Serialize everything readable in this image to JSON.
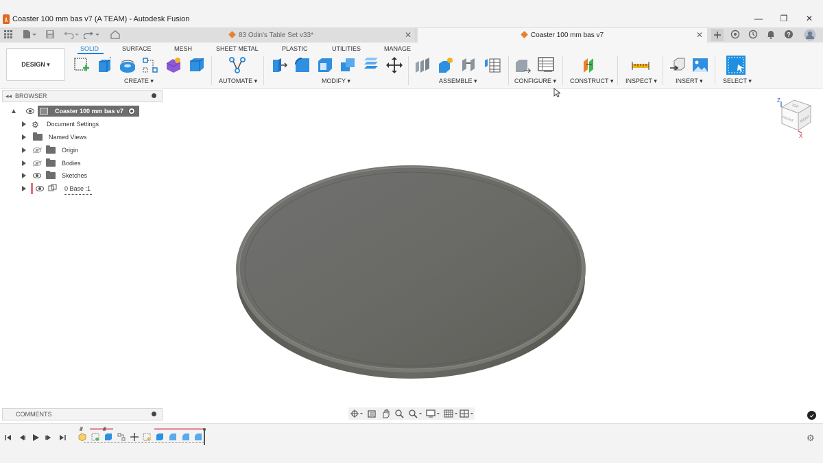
{
  "window": {
    "title": "Coaster 100 mm bas v7 (A TEAM) - Autodesk Fusion",
    "minimize": "—",
    "restore": "❐",
    "close": "✕"
  },
  "tabs": [
    {
      "label": "83 Odin's Table Set v33*",
      "close": "✕",
      "active": false
    },
    {
      "label": "Coaster 100 mm bas v7",
      "close": "✕",
      "active": true
    }
  ],
  "toolbar": {
    "workspace": "DESIGN",
    "workspace_caret": "▾",
    "tabs": [
      "SOLID",
      "SURFACE",
      "MESH",
      "SHEET METAL",
      "PLASTIC",
      "UTILITIES",
      "MANAGE"
    ],
    "groups": [
      "CREATE ▾",
      "AUTOMATE ▾",
      "MODIFY ▾",
      "ASSEMBLE ▾",
      "CONFIGURE ▾",
      "CONSTRUCT ▾",
      "INSPECT ▾",
      "INSERT ▾",
      "SELECT ▾"
    ]
  },
  "browser": {
    "title": "BROWSER",
    "root": "Coaster 100 mm bas v7",
    "items": [
      {
        "label": "Document Settings",
        "icon": "gear-icon"
      },
      {
        "label": "Named Views",
        "icon": "folder-icon"
      },
      {
        "label": "Origin",
        "icon": "folder-icon",
        "visibility": "hidden"
      },
      {
        "label": "Bodies",
        "icon": "folder-icon",
        "visibility": "hidden"
      },
      {
        "label": "Sketches",
        "icon": "folder-icon",
        "visibility": "visible"
      },
      {
        "label": "0 Base :1",
        "icon": "component-icon",
        "visibility": "visible"
      }
    ]
  },
  "comments": {
    "title": "COMMENTS"
  },
  "viewcube": {
    "z": "Z",
    "x": "X",
    "top": "TOP",
    "front": "FRONT",
    "right": "RIGHT"
  },
  "colors": {
    "accent": "#1f7fd6",
    "coaster": "#6b6b66",
    "brand": "#e0691b"
  }
}
